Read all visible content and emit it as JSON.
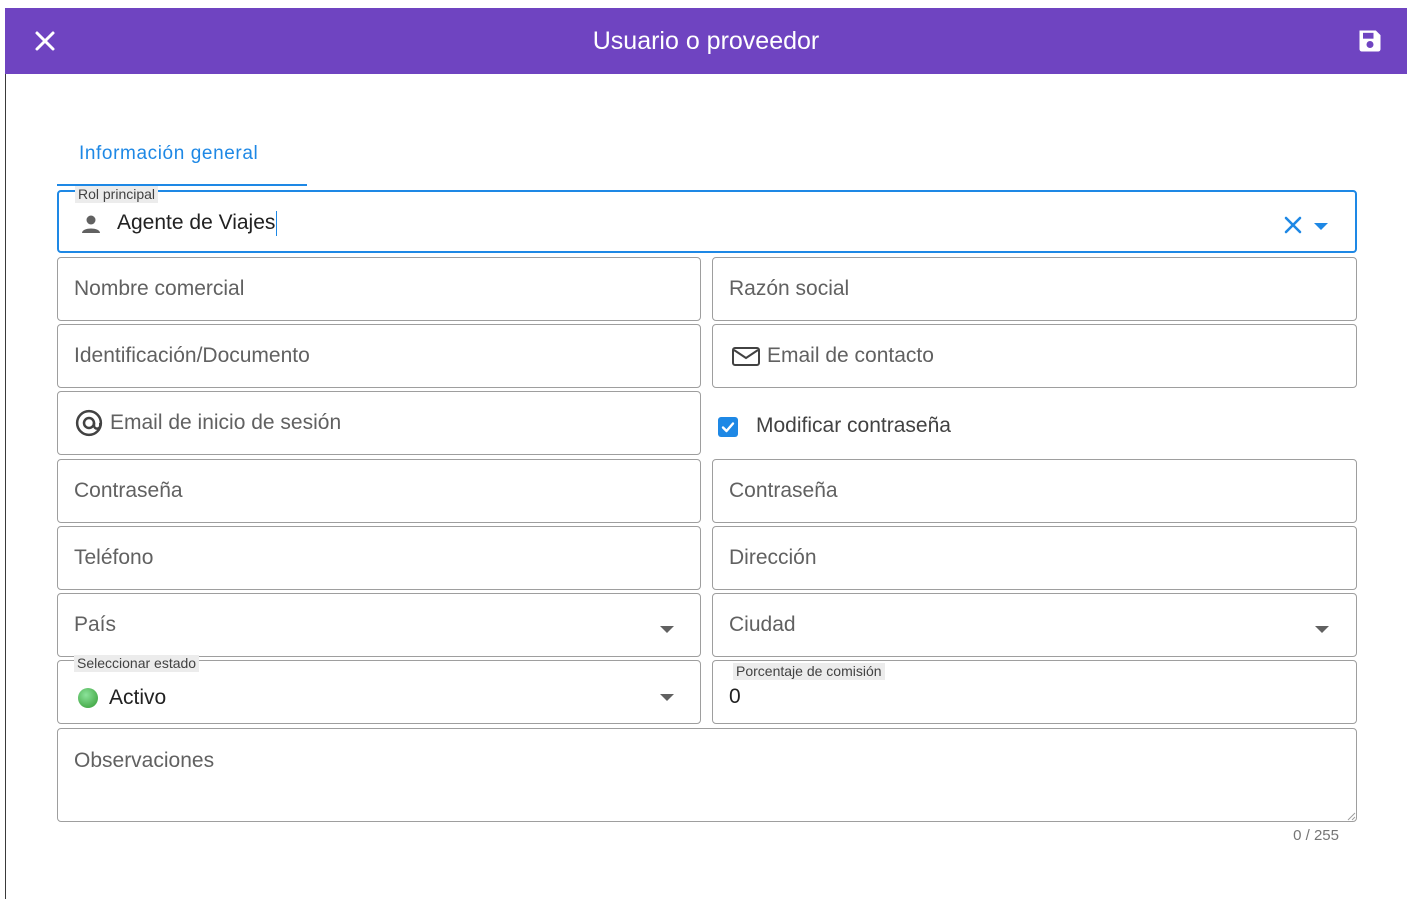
{
  "header": {
    "title": "Usuario o proveedor",
    "background": "#6f44c1"
  },
  "tabs": [
    {
      "label": "Información general",
      "active": true
    }
  ],
  "form": {
    "rol_principal": {
      "label": "Rol principal",
      "value": "Agente de Viajes",
      "icon": "person-icon"
    },
    "nombre_comercial": {
      "placeholder": "Nombre comercial"
    },
    "razon_social": {
      "placeholder": "Razón social"
    },
    "identificacion": {
      "placeholder": "Identificación/Documento"
    },
    "email_contacto": {
      "placeholder": "Email de contacto",
      "icon": "mail-icon"
    },
    "email_inicio": {
      "placeholder": "Email de inicio de sesión",
      "icon": "at-icon"
    },
    "modificar_contrasena": {
      "label": "Modificar contraseña",
      "checked": true
    },
    "contrasena": {
      "placeholder": "Contraseña"
    },
    "contrasena_confirm": {
      "placeholder": "Contraseña"
    },
    "telefono": {
      "placeholder": "Teléfono"
    },
    "direccion": {
      "placeholder": "Dirección"
    },
    "pais": {
      "placeholder": "País"
    },
    "ciudad": {
      "placeholder": "Ciudad"
    },
    "estado": {
      "label": "Seleccionar estado",
      "value": "Activo",
      "status_color": "#4caf50"
    },
    "comision": {
      "label": "Porcentaje de comisión",
      "value": "0"
    },
    "observaciones": {
      "placeholder": "Observaciones",
      "counter": "0 / 255"
    }
  },
  "colors": {
    "accent": "#1e88e5"
  }
}
